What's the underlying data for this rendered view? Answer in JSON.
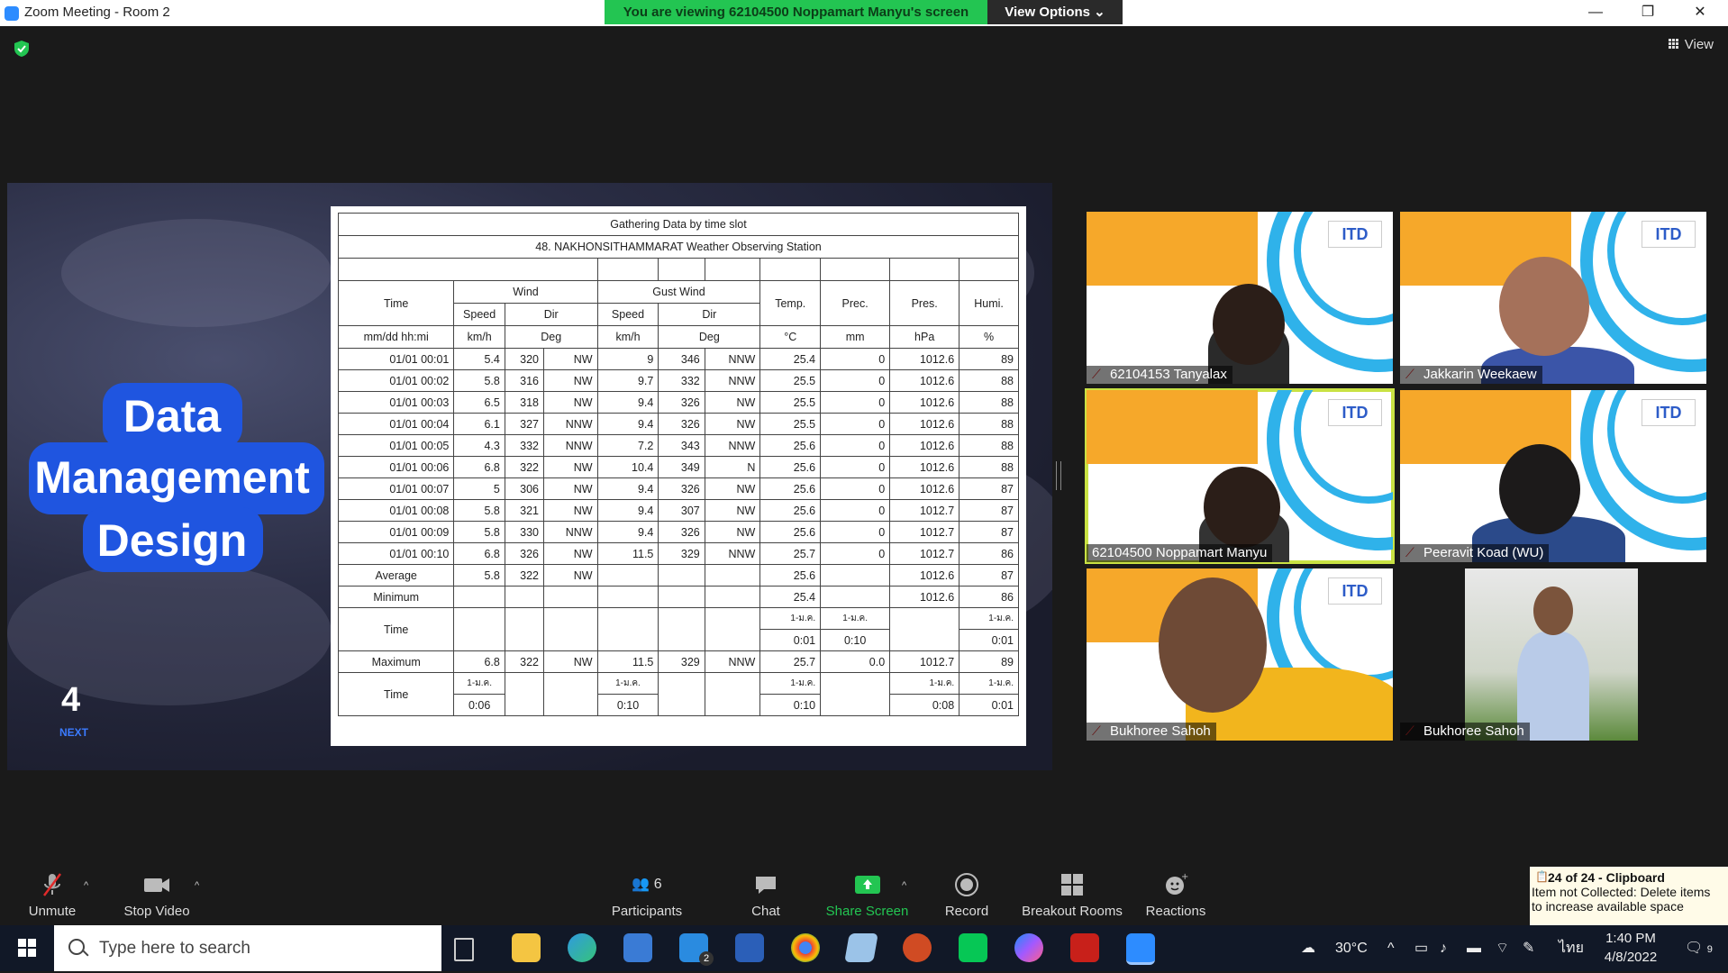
{
  "window": {
    "title": "Zoom Meeting - Room 2",
    "viewing_banner": "You are viewing 62104500 Noppamart Manyu's screen",
    "view_options": "View Options",
    "view_label": "View",
    "minimize": "—",
    "restore": "❐",
    "close": "✕"
  },
  "slide": {
    "title_lines": [
      "Data",
      "Management",
      "Design"
    ],
    "page_number": "4",
    "next_label": "NEXT",
    "table": {
      "title": "Gathering Data by time slot",
      "station": "48. NAKHONSITHAMMARAT Weather Observing Station",
      "headers": {
        "time": "Time",
        "wind": "Wind",
        "gust": "Gust Wind",
        "temp": "Temp.",
        "prec": "Prec.",
        "pres": "Pres.",
        "humi": "Humi.",
        "speed": "Speed",
        "dir": "Dir",
        "speed2": "Speed",
        "dir2": "Dir"
      },
      "units": [
        "mm/dd hh:mi",
        "km/h",
        "Deg",
        "km/h",
        "Deg",
        "°C",
        "mm",
        "hPa",
        "%"
      ],
      "rows": [
        [
          "01/01 00:01",
          "5.4",
          "320",
          "NW",
          "9",
          "346",
          "NNW",
          "25.4",
          "0",
          "1012.6",
          "89"
        ],
        [
          "01/01 00:02",
          "5.8",
          "316",
          "NW",
          "9.7",
          "332",
          "NNW",
          "25.5",
          "0",
          "1012.6",
          "88"
        ],
        [
          "01/01 00:03",
          "6.5",
          "318",
          "NW",
          "9.4",
          "326",
          "NW",
          "25.5",
          "0",
          "1012.6",
          "88"
        ],
        [
          "01/01 00:04",
          "6.1",
          "327",
          "NNW",
          "9.4",
          "326",
          "NW",
          "25.5",
          "0",
          "1012.6",
          "88"
        ],
        [
          "01/01 00:05",
          "4.3",
          "332",
          "NNW",
          "7.2",
          "343",
          "NNW",
          "25.6",
          "0",
          "1012.6",
          "88"
        ],
        [
          "01/01 00:06",
          "6.8",
          "322",
          "NW",
          "10.4",
          "349",
          "N",
          "25.6",
          "0",
          "1012.6",
          "88"
        ],
        [
          "01/01 00:07",
          "5",
          "306",
          "NW",
          "9.4",
          "326",
          "NW",
          "25.6",
          "0",
          "1012.6",
          "87"
        ],
        [
          "01/01 00:08",
          "5.8",
          "321",
          "NW",
          "9.4",
          "307",
          "NW",
          "25.6",
          "0",
          "1012.7",
          "87"
        ],
        [
          "01/01 00:09",
          "5.8",
          "330",
          "NNW",
          "9.4",
          "326",
          "NW",
          "25.6",
          "0",
          "1012.7",
          "87"
        ],
        [
          "01/01 00:10",
          "6.8",
          "326",
          "NW",
          "11.5",
          "329",
          "NNW",
          "25.7",
          "0",
          "1012.7",
          "86"
        ]
      ],
      "average": [
        "Average",
        "5.8",
        "322",
        "NW",
        "",
        "",
        "",
        "25.6",
        "",
        "1012.6",
        "87"
      ],
      "minimum": [
        "Minimum",
        "",
        "",
        "",
        "",
        "",
        "",
        "25.4",
        "",
        "1012.6",
        "86"
      ],
      "min_time": {
        "label": "Time",
        "temp_a": "1-ม.ค.",
        "prec_a": "1-ม.ค.",
        "humi_a": "1-ม.ค.",
        "temp_b": "0:01",
        "prec_b": "0:10",
        "humi_b": "0:01"
      },
      "maximum": [
        "Maximum",
        "6.8",
        "322",
        "NW",
        "11.5",
        "329",
        "NNW",
        "25.7",
        "0.0",
        "1012.7",
        "89"
      ],
      "max_time": {
        "label": "Time",
        "speed_a": "1-ม.ค.",
        "gust_a": "1-ม.ค.",
        "temp_a": "1-ม.ค.",
        "pres_a": "1-ม.ค.",
        "humi_a": "1-ม.ค.",
        "speed_b": "0:06",
        "gust_b": "0:10",
        "temp_b": "0:10",
        "pres_b": "0:08",
        "humi_b": "0:01"
      }
    }
  },
  "participants_gallery": [
    {
      "name": "62104153 Tanyalax",
      "muted": true
    },
    {
      "name": "Jakkarin Weekaew",
      "muted": true
    },
    {
      "name": "62104500 Noppamart Manyu",
      "muted": false,
      "active": true
    },
    {
      "name": "Peeravit Koad (WU)",
      "muted": true
    },
    {
      "name": "Bukhoree Sahoh",
      "muted": true
    },
    {
      "name": "Bukhoree Sahoh",
      "muted": true
    }
  ],
  "tile_logo": "ITD",
  "toolbar": {
    "unmute": "Unmute",
    "stop_video": "Stop Video",
    "participants": "Participants",
    "participants_count": "6",
    "chat": "Chat",
    "share_screen": "Share Screen",
    "record": "Record",
    "breakout_rooms": "Breakout Rooms",
    "reactions": "Reactions"
  },
  "clipboard": {
    "title": "24 of 24 - Clipboard",
    "message_1": "Item not Collected: Delete items",
    "message_2": "to increase available space"
  },
  "taskbar": {
    "search_placeholder": "Type here to search",
    "weather": "30°C",
    "language": "ไทย",
    "time": "1:40 PM",
    "date": "4/8/2022",
    "notifications": "9",
    "mail_badge": "2"
  },
  "colors": {
    "zoom_green": "#23c552",
    "zoom_blue": "#2d8cff",
    "slide_blue": "#1f55e0",
    "active_speaker": "#c9e243"
  }
}
